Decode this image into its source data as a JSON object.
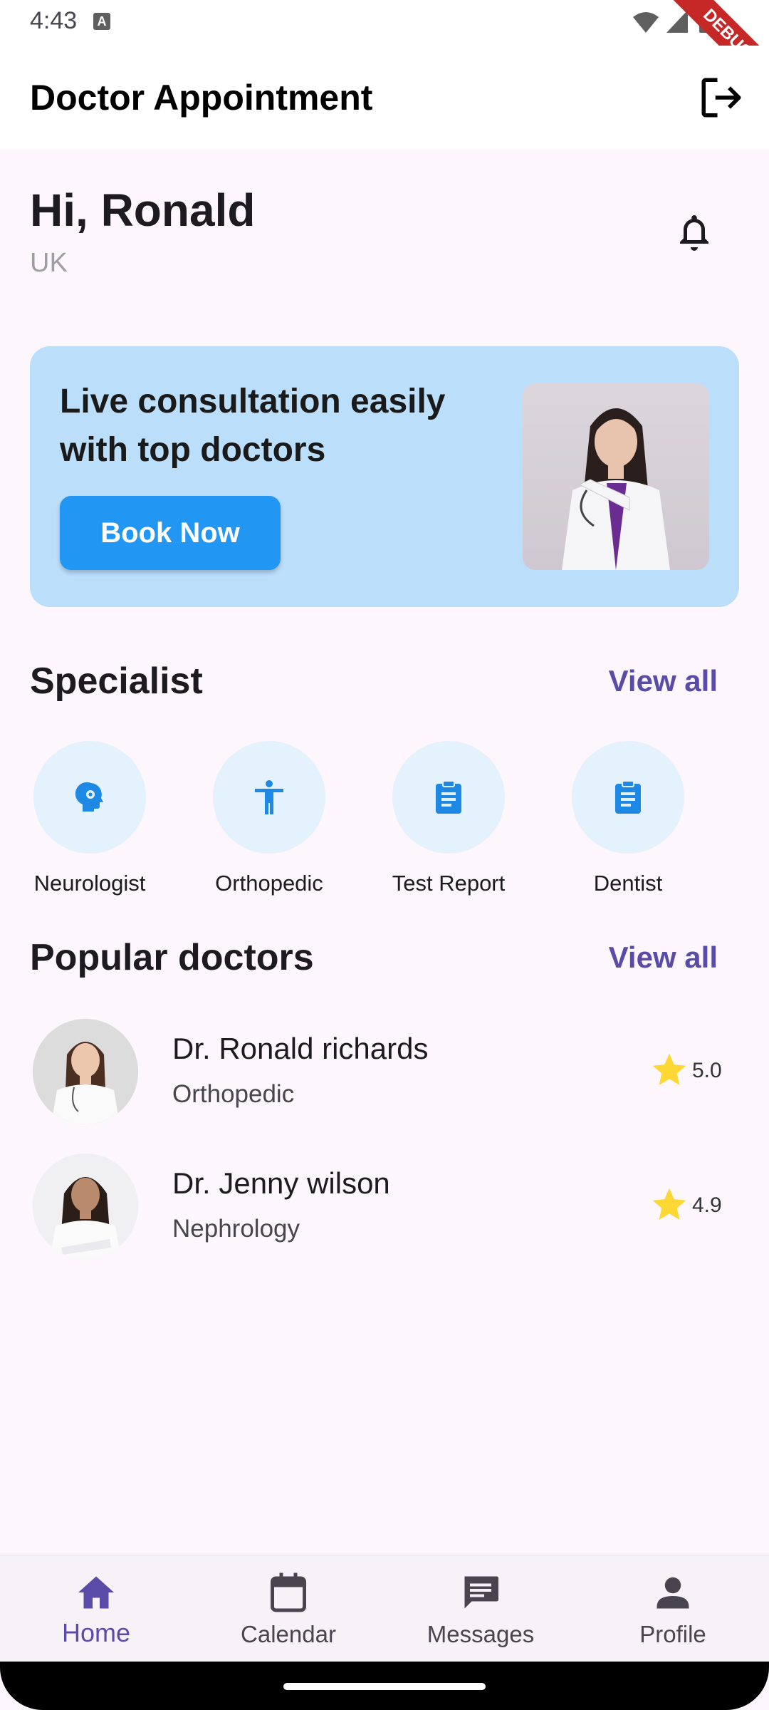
{
  "status": {
    "time": "4:43",
    "debug": "DEBUG"
  },
  "appbar": {
    "title": "Doctor Appointment"
  },
  "greeting": {
    "text": "Hi, Ronald",
    "location": "UK"
  },
  "banner": {
    "headline": "Live consultation easily with top doctors",
    "button": "Book Now"
  },
  "specialist": {
    "title": "Specialist",
    "view_all": "View all",
    "items": [
      {
        "label": "Neurologist",
        "icon": "brain-gear-icon"
      },
      {
        "label": "Orthopedic",
        "icon": "accessibility-icon"
      },
      {
        "label": "Test Report",
        "icon": "clipboard-icon"
      },
      {
        "label": "Dentist",
        "icon": "clipboard-icon"
      }
    ]
  },
  "popular": {
    "title": "Popular doctors",
    "view_all": "View all",
    "doctors": [
      {
        "name": "Dr. Ronald richards",
        "specialty": "Orthopedic",
        "rating": "5.0"
      },
      {
        "name": "Dr. Jenny wilson",
        "specialty": "Nephrology",
        "rating": "4.9"
      }
    ]
  },
  "nav": {
    "items": [
      {
        "label": "Home",
        "icon": "home-icon",
        "active": true
      },
      {
        "label": "Calendar",
        "icon": "calendar-icon",
        "active": false
      },
      {
        "label": "Messages",
        "icon": "message-icon",
        "active": false
      },
      {
        "label": "Profile",
        "icon": "person-icon",
        "active": false
      }
    ]
  },
  "colors": {
    "accent": "#5b4ba8",
    "primary_blue": "#2196f3",
    "banner_bg": "#bbdefb",
    "icon_circle": "#e3f2fd",
    "star": "#fdd835",
    "page_bg": "#fdf6fc"
  }
}
